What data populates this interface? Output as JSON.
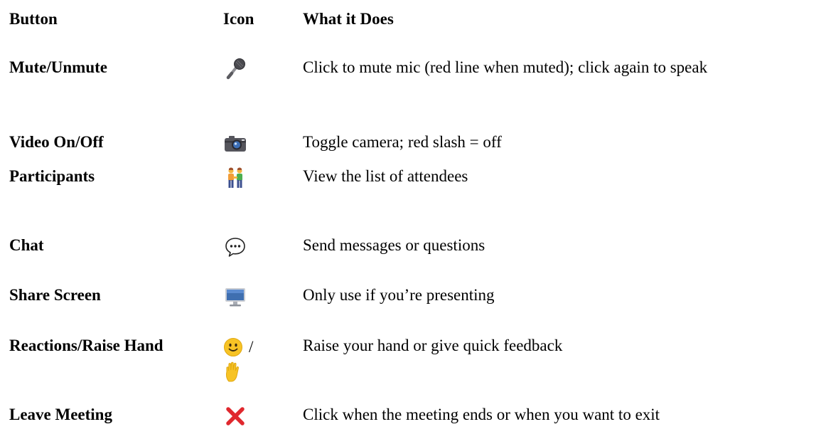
{
  "headers": {
    "button": "Button",
    "icon": "Icon",
    "description": "What it Does"
  },
  "rows": [
    {
      "button": "Mute/Unmute",
      "icon": "microphone-icon",
      "description": "Click to mute mic (red line when muted); click again to speak"
    },
    {
      "button": "Video On/Off",
      "icon": "camera-icon",
      "description": "Toggle camera; red slash = off"
    },
    {
      "button": "Participants",
      "icon": "two-people-icon",
      "description": "View the list of attendees"
    },
    {
      "button": "Chat",
      "icon": "speech-bubble-icon",
      "description": "Send messages or questions"
    },
    {
      "button": "Share Screen",
      "icon": "monitor-icon",
      "description": "Only use if you’re presenting"
    },
    {
      "button": "Reactions/Raise Hand",
      "icon": "smiley-icon",
      "icon_separator": "/",
      "icon2": "raised-hand-icon",
      "description": "Raise your hand or give quick feedback"
    },
    {
      "button": "Leave Meeting",
      "icon": "red-x-icon",
      "description": "Click when the meeting ends or when you want to exit"
    }
  ],
  "colors": {
    "text": "#000000",
    "background": "#ffffff",
    "leave_icon": "#e0282e",
    "smiley": "#f7c325"
  }
}
